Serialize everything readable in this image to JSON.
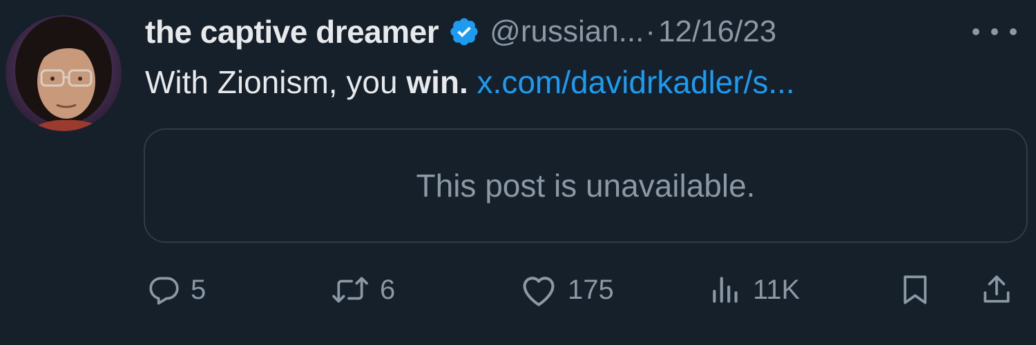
{
  "tweet": {
    "display_name": "the captive dreamer",
    "handle": "@russian...",
    "separator": "·",
    "date": "12/16/23",
    "text_before": "With Zionism, you ",
    "text_bold": "win.",
    "link_text": "x.com/davidrkadler/s...",
    "quoted_unavailable": "This post is unavailable.",
    "avatar_icon": "user-avatar-photo",
    "verified_icon": "verified-badge-icon",
    "colors": {
      "background": "#15202b",
      "link": "#1d9bf0",
      "verified": "#1d9bf0",
      "muted": "#8b98a5"
    }
  },
  "actions": {
    "reply_count": "5",
    "retweet_count": "6",
    "like_count": "175",
    "views_count": "11K",
    "icons": [
      "reply-icon",
      "retweet-icon",
      "like-icon",
      "views-icon",
      "bookmark-icon",
      "share-icon"
    ]
  }
}
